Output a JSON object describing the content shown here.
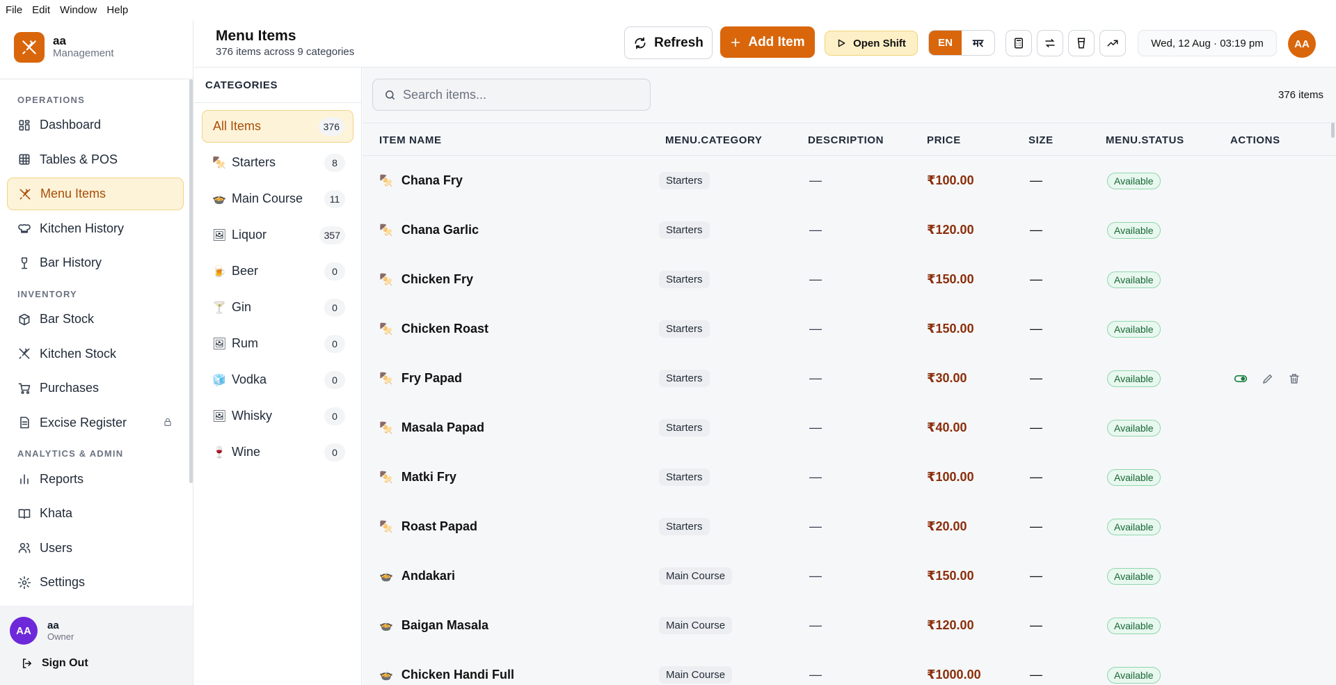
{
  "os_menu": [
    "File",
    "Edit",
    "Window",
    "Help"
  ],
  "brand": {
    "name": "aa",
    "subtitle": "Management"
  },
  "sidebar": {
    "sections": [
      {
        "title": "OPERATIONS",
        "items": [
          {
            "label": "Dashboard",
            "icon": "dashboard-icon"
          },
          {
            "label": "Tables & POS",
            "icon": "table-icon"
          },
          {
            "label": "Menu Items",
            "icon": "utensils-icon",
            "active": true
          },
          {
            "label": "Kitchen History",
            "icon": "chef-hat-icon"
          },
          {
            "label": "Bar History",
            "icon": "wine-glass-icon"
          }
        ]
      },
      {
        "title": "INVENTORY",
        "items": [
          {
            "label": "Bar Stock",
            "icon": "box-icon"
          },
          {
            "label": "Kitchen Stock",
            "icon": "utensils-icon"
          },
          {
            "label": "Purchases",
            "icon": "cart-icon"
          },
          {
            "label": "Excise Register",
            "icon": "document-icon",
            "locked": true
          }
        ]
      },
      {
        "title": "ANALYTICS & ADMIN",
        "items": [
          {
            "label": "Reports",
            "icon": "bar-chart-icon"
          },
          {
            "label": "Khata",
            "icon": "book-icon"
          },
          {
            "label": "Users",
            "icon": "users-icon"
          },
          {
            "label": "Settings",
            "icon": "gear-icon"
          }
        ]
      }
    ],
    "user": {
      "initials": "AA",
      "name": "aa",
      "role": "Owner",
      "avatar_color": "#6d28d9"
    },
    "sign_out": "Sign Out"
  },
  "header": {
    "title": "Menu Items",
    "subtitle": "376 items across 9 categories",
    "refresh_label": "Refresh",
    "add_label": "Add Item",
    "shift_label": "Open Shift",
    "lang_en": "EN",
    "lang_mr": "मर",
    "datetime": "Wed, 12 Aug · 03:19 pm",
    "avatar_initials": "AA"
  },
  "categories": {
    "heading": "CATEGORIES",
    "items": [
      {
        "label": "All Items",
        "count": "376",
        "icon": "",
        "active": true
      },
      {
        "label": "Starters",
        "count": "8",
        "icon": "🍢"
      },
      {
        "label": "Main Course",
        "count": "11",
        "icon": "🍲"
      },
      {
        "label": "Liquor",
        "count": "357",
        "icon": "🖼"
      },
      {
        "label": "Beer",
        "count": "0",
        "icon": "🍺"
      },
      {
        "label": "Gin",
        "count": "0",
        "icon": "🍸"
      },
      {
        "label": "Rum",
        "count": "0",
        "icon": "🖼"
      },
      {
        "label": "Vodka",
        "count": "0",
        "icon": "🧊"
      },
      {
        "label": "Whisky",
        "count": "0",
        "icon": "🖼"
      },
      {
        "label": "Wine",
        "count": "0",
        "icon": "🍷"
      }
    ]
  },
  "table": {
    "search_placeholder": "Search items...",
    "count_label": "376 items",
    "columns": [
      "ITEM NAME",
      "MENU.CATEGORY",
      "DESCRIPTION",
      "PRICE",
      "SIZE",
      "MENU.STATUS",
      "ACTIONS"
    ],
    "rows": [
      {
        "icon": "🍢",
        "name": "Chana Fry",
        "category": "Starters",
        "description": "—",
        "price": "₹100.00",
        "size": "—",
        "status": "Available"
      },
      {
        "icon": "🍢",
        "name": "Chana Garlic",
        "category": "Starters",
        "description": "—",
        "price": "₹120.00",
        "size": "—",
        "status": "Available"
      },
      {
        "icon": "🍢",
        "name": "Chicken Fry",
        "category": "Starters",
        "description": "—",
        "price": "₹150.00",
        "size": "—",
        "status": "Available"
      },
      {
        "icon": "🍢",
        "name": "Chicken Roast",
        "category": "Starters",
        "description": "—",
        "price": "₹150.00",
        "size": "—",
        "status": "Available"
      },
      {
        "icon": "🍢",
        "name": "Fry Papad",
        "category": "Starters",
        "description": "—",
        "price": "₹30.00",
        "size": "—",
        "status": "Available",
        "show_actions": true
      },
      {
        "icon": "🍢",
        "name": "Masala Papad",
        "category": "Starters",
        "description": "—",
        "price": "₹40.00",
        "size": "—",
        "status": "Available"
      },
      {
        "icon": "🍢",
        "name": "Matki Fry",
        "category": "Starters",
        "description": "—",
        "price": "₹100.00",
        "size": "—",
        "status": "Available"
      },
      {
        "icon": "🍢",
        "name": "Roast Papad",
        "category": "Starters",
        "description": "—",
        "price": "₹20.00",
        "size": "—",
        "status": "Available"
      },
      {
        "icon": "🍲",
        "name": "Andakari",
        "category": "Main Course",
        "description": "—",
        "price": "₹150.00",
        "size": "—",
        "status": "Available"
      },
      {
        "icon": "🍲",
        "name": "Baigan Masala",
        "category": "Main Course",
        "description": "—",
        "price": "₹120.00",
        "size": "—",
        "status": "Available"
      },
      {
        "icon": "🍲",
        "name": "Chicken Handi Full",
        "category": "Main Course",
        "description": "—",
        "price": "₹1000.00",
        "size": "—",
        "status": "Available"
      }
    ]
  },
  "colors": {
    "accent": "#d9660b",
    "active_bg": "#fdf3d9",
    "price": "#8a2e0a",
    "status_green": "#166534"
  }
}
